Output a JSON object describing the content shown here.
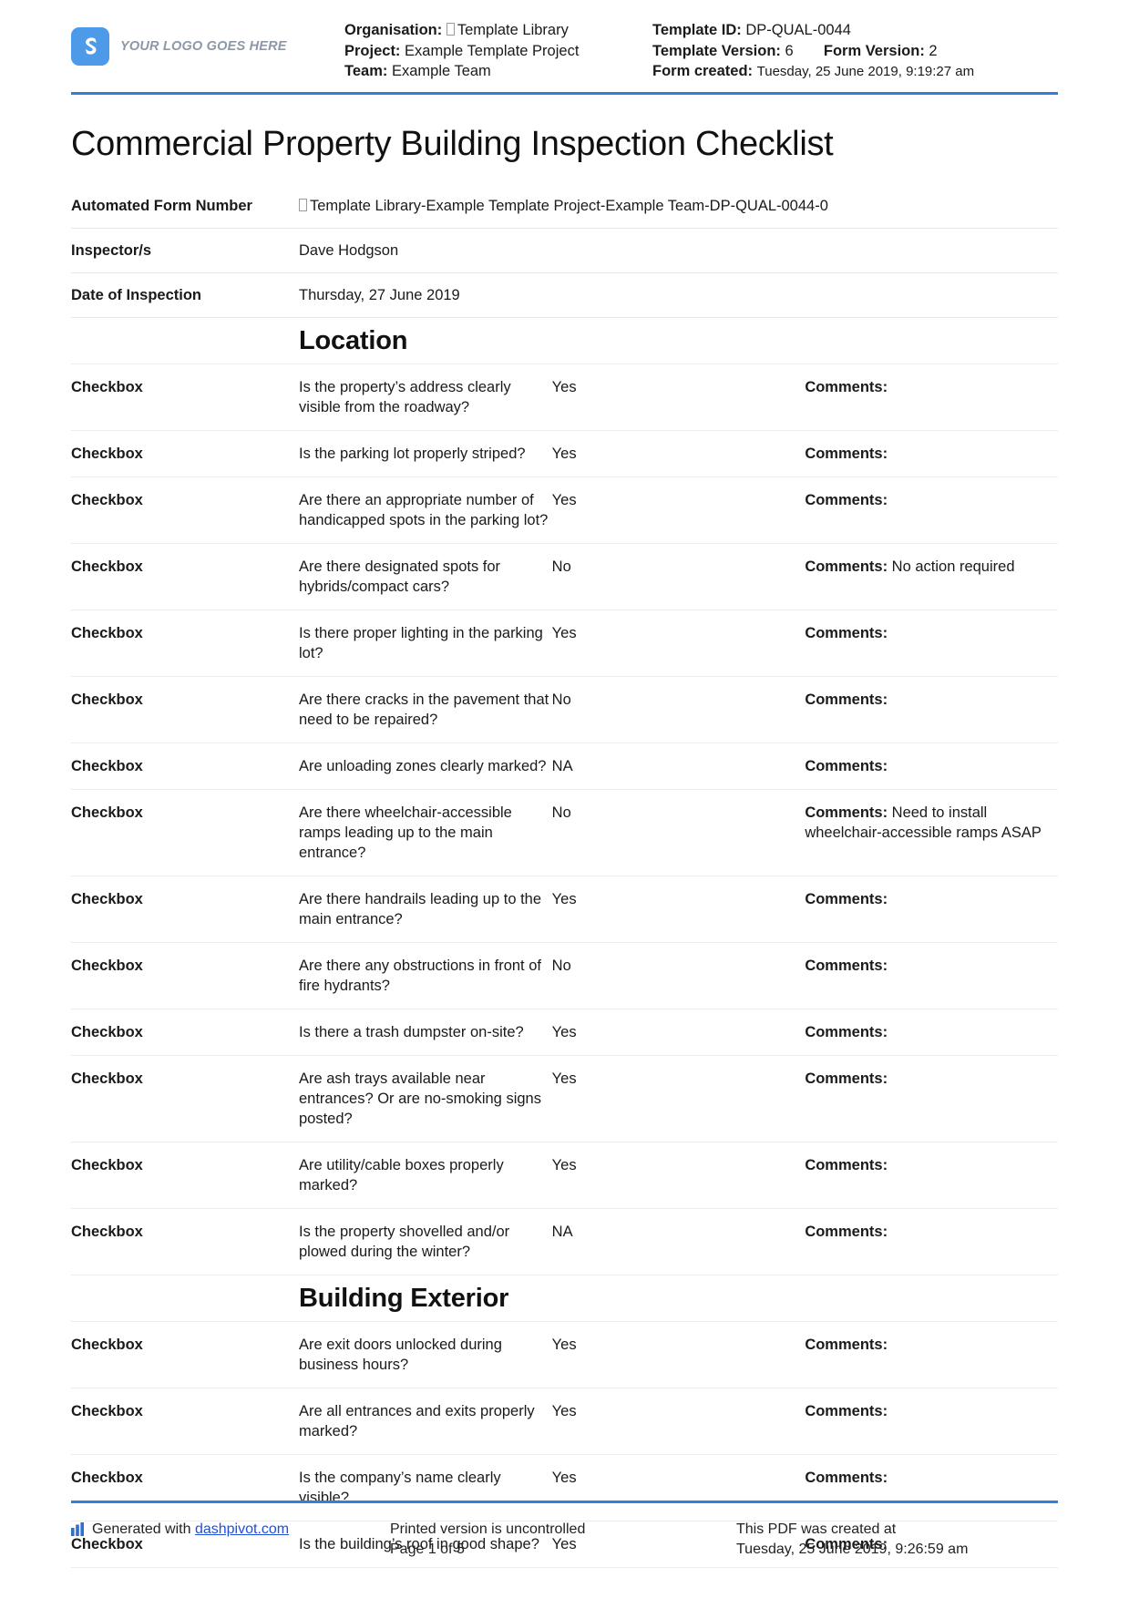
{
  "header": {
    "logo_text": "YOUR LOGO GOES HERE",
    "logo_icon": "dashpivot-logo-icon",
    "accent_color": "#2f80d8",
    "left": {
      "organisation_label": "Organisation:",
      "organisation_value": "Template Library",
      "project_label": "Project:",
      "project_value": "Example Template Project",
      "team_label": "Team:",
      "team_value": "Example Team"
    },
    "right": {
      "template_id_label": "Template ID:",
      "template_id_value": "DP-QUAL-0044",
      "template_version_label": "Template Version:",
      "template_version_value": "6",
      "form_version_label": "Form Version:",
      "form_version_value": "2",
      "form_created_label": "Form created:",
      "form_created_value": "Tuesday, 25 June 2019, 9:19:27 am"
    }
  },
  "title": "Commercial Property Building Inspection Checklist",
  "info_rows": [
    {
      "label": "Automated Form Number",
      "value": "Template Library-Example Template Project-Example Team-DP-QUAL-0044-0"
    },
    {
      "label": "Inspector/s",
      "value": "Dave Hodgson"
    },
    {
      "label": "Date of Inspection",
      "value": "Thursday, 27 June 2019"
    }
  ],
  "comments_label": "Comments:",
  "sections": [
    {
      "heading": "Location",
      "rows": [
        {
          "type": "Checkbox",
          "question": "Is the property’s address clearly visible from the roadway?",
          "answer": "Yes",
          "comment": ""
        },
        {
          "type": "Checkbox",
          "question": "Is the parking lot properly striped?",
          "answer": "Yes",
          "comment": ""
        },
        {
          "type": "Checkbox",
          "question": "Are there an appropriate number of handicapped spots in the parking lot?",
          "answer": "Yes",
          "comment": ""
        },
        {
          "type": "Checkbox",
          "question": "Are there designated spots for hybrids/compact cars?",
          "answer": "No",
          "comment": "No action required"
        },
        {
          "type": "Checkbox",
          "question": "Is there proper lighting in the parking lot?",
          "answer": "Yes",
          "comment": ""
        },
        {
          "type": "Checkbox",
          "question": "Are there cracks in the pavement that need to be repaired?",
          "answer": "No",
          "comment": ""
        },
        {
          "type": "Checkbox",
          "question": "Are unloading zones clearly marked?",
          "answer": "NA",
          "comment": ""
        },
        {
          "type": "Checkbox",
          "question": "Are there wheelchair-accessible ramps leading up to the main entrance?",
          "answer": "No",
          "comment": "Need to install wheelchair-accessible ramps ASAP"
        },
        {
          "type": "Checkbox",
          "question": "Are there handrails leading up to the main entrance?",
          "answer": "Yes",
          "comment": ""
        },
        {
          "type": "Checkbox",
          "question": "Are there any obstructions in front of fire hydrants?",
          "answer": "No",
          "comment": ""
        },
        {
          "type": "Checkbox",
          "question": "Is there a trash dumpster on-site?",
          "answer": "Yes",
          "comment": ""
        },
        {
          "type": "Checkbox",
          "question": "Are ash trays available near entrances? Or are no-smoking signs posted?",
          "answer": "Yes",
          "comment": ""
        },
        {
          "type": "Checkbox",
          "question": "Are utility/cable boxes properly marked?",
          "answer": "Yes",
          "comment": ""
        },
        {
          "type": "Checkbox",
          "question": "Is the property shovelled and/or plowed during the winter?",
          "answer": "NA",
          "comment": ""
        }
      ]
    },
    {
      "heading": "Building Exterior",
      "rows": [
        {
          "type": "Checkbox",
          "question": "Are exit doors unlocked during business hours?",
          "answer": "Yes",
          "comment": ""
        },
        {
          "type": "Checkbox",
          "question": "Are all entrances and exits properly marked?",
          "answer": "Yes",
          "comment": ""
        },
        {
          "type": "Checkbox",
          "question": "Is the company’s name clearly visible?",
          "answer": "Yes",
          "comment": ""
        },
        {
          "type": "Checkbox",
          "question": "Is the building’s roof in good shape?",
          "answer": "Yes",
          "comment": ""
        }
      ]
    }
  ],
  "footer": {
    "generated_prefix": "Generated with ",
    "generated_link": "dashpivot.com",
    "printed_line1": "Printed version is uncontrolled",
    "printed_line2": "Page 1 of 5",
    "created_line1": "This PDF was created at",
    "created_line2": "Tuesday, 25 June 2019, 9:26:59 am",
    "chart_icon": "bar-chart-icon"
  }
}
